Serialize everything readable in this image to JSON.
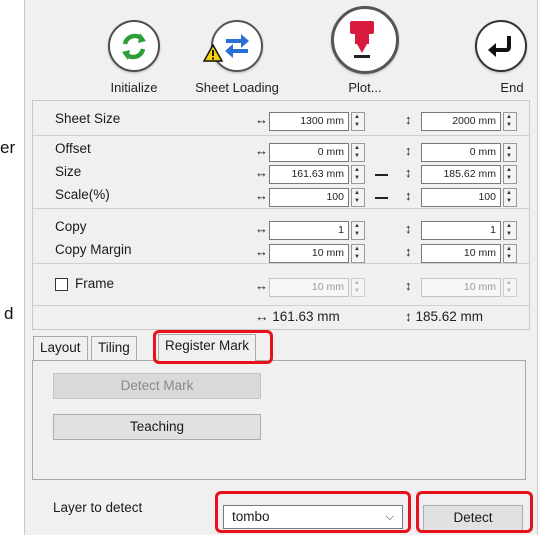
{
  "edge_labels": {
    "er": "er",
    "d": "d"
  },
  "toolbar": {
    "initialize": {
      "label": "Initialize",
      "icon": "refresh-icon"
    },
    "sheet_loading": {
      "label": "Sheet Loading",
      "icon": "swap-arrows-icon",
      "warning": "warning-icon"
    },
    "plot": {
      "label": "Plot...",
      "icon": "plotter-icon"
    },
    "end": {
      "label": "End",
      "icon": "return-arrow-icon"
    }
  },
  "rows": {
    "sheet_size": {
      "label": "Sheet Size",
      "h": "1300 mm",
      "v": "2000 mm"
    },
    "offset": {
      "label": "Offset",
      "h": "0 mm",
      "v": "0 mm"
    },
    "size": {
      "label": "Size",
      "h": "161.63 mm",
      "v": "185.62 mm"
    },
    "scale": {
      "label": "Scale(%)",
      "h": "100",
      "v": "100"
    },
    "copy": {
      "label": "Copy",
      "h": "1",
      "v": "1"
    },
    "copy_margin": {
      "label": "Copy Margin",
      "h": "10 mm",
      "v": "10 mm"
    },
    "frame": {
      "label": "Frame",
      "h": "10 mm",
      "v": "10 mm",
      "checked": false
    }
  },
  "totals": {
    "h": "↔ 161.63 mm",
    "v": "↕ 185.62 mm"
  },
  "arrows": {
    "h": "↔",
    "v": "↕"
  },
  "tabs": {
    "layout": "Layout",
    "tiling": "Tiling",
    "register_mark": "Register Mark",
    "active": "Register Mark"
  },
  "register_panel": {
    "detect_mark": "Detect Mark",
    "teaching": "Teaching",
    "layer_label": "Layer to detect",
    "layer_value": "tombo",
    "detect": "Detect"
  },
  "colors": {
    "highlight": "#e8101a",
    "plot_icon": "#d81b3c",
    "init_icon": "#2e9e3b",
    "sheet_icon": "#2a6fd6"
  }
}
